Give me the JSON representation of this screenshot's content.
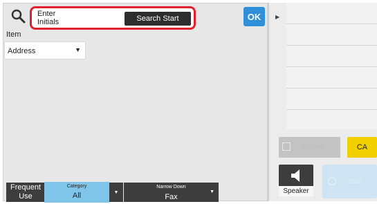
{
  "search": {
    "placeholder_line1": "Enter",
    "placeholder_line2": "Initials",
    "start_label": "Search Start",
    "icon": "search-icon"
  },
  "ok_label": "OK",
  "item": {
    "label": "Item",
    "selected": "Address"
  },
  "bottom": {
    "frequent_line1": "Frequent",
    "frequent_line2": "Use",
    "category_caption": "Category",
    "category_value": "All",
    "narrow_caption": "Narrow Down",
    "narrow_value": "Fax"
  },
  "right": {
    "preview_label": "Preview",
    "ca_label": "CA",
    "speaker_label": "Speaker",
    "start_label": "Start"
  },
  "colors": {
    "search_highlight": "#e0212b",
    "ok": "#2f8fd8",
    "category": "#7fc5e9",
    "ca": "#f2d000",
    "start": "#cfe4f2"
  }
}
